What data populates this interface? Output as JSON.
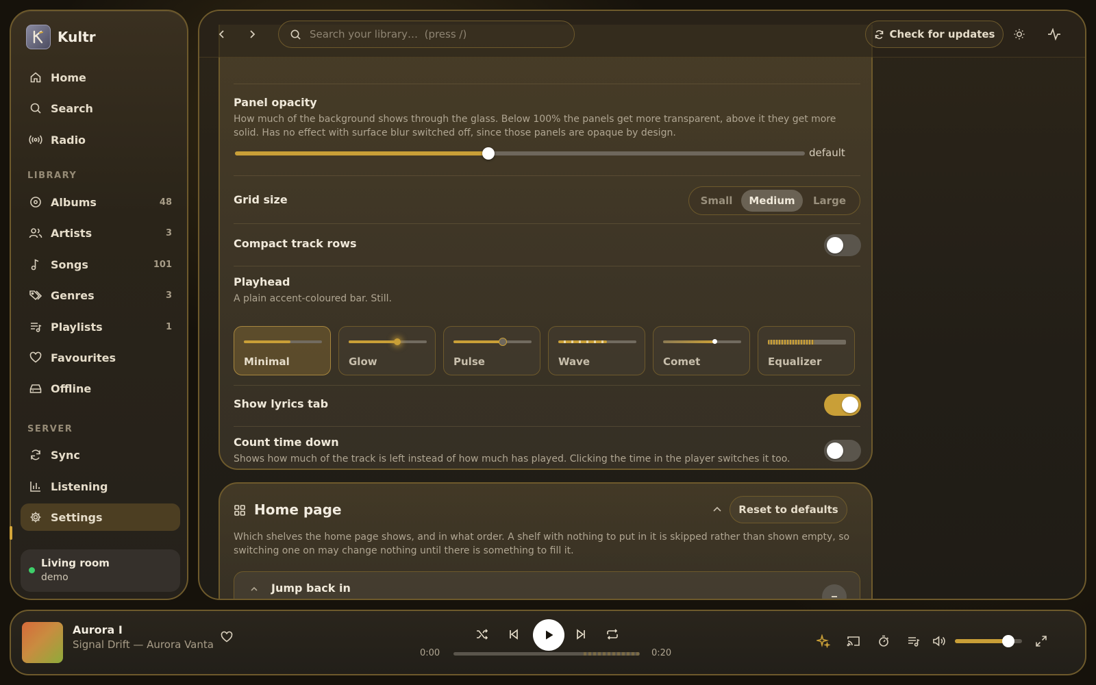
{
  "app": {
    "name": "Kultr"
  },
  "sidebar": {
    "nav": [
      {
        "label": "Home"
      },
      {
        "label": "Search"
      },
      {
        "label": "Radio"
      }
    ],
    "library_heading": "LIBRARY",
    "library": [
      {
        "label": "Albums",
        "count": "48"
      },
      {
        "label": "Artists",
        "count": "3"
      },
      {
        "label": "Songs",
        "count": "101"
      },
      {
        "label": "Genres",
        "count": "3"
      },
      {
        "label": "Playlists",
        "count": "1"
      },
      {
        "label": "Favourites",
        "count": ""
      },
      {
        "label": "Offline",
        "count": ""
      }
    ],
    "server_heading": "SERVER",
    "server_items": [
      {
        "label": "Sync"
      },
      {
        "label": "Listening"
      },
      {
        "label": "Settings",
        "active": true
      }
    ],
    "server": {
      "name": "Living room",
      "user": "demo",
      "status_color": "#3ecf6a"
    }
  },
  "topbar": {
    "search_placeholder": "Search your library…  (press /)",
    "update_label": "Check for updates"
  },
  "appearance": {
    "panel_opacity": {
      "title": "Panel opacity",
      "description": "How much of the background shows through the glass. Below 100% the panels get more transparent, above it they get more solid. Has no effect with surface blur switched off, since those panels are opaque by design.",
      "value_label": "default",
      "level": 0.445
    },
    "grid_size": {
      "title": "Grid size",
      "options": [
        "Small",
        "Medium",
        "Large"
      ],
      "selected": "Medium"
    },
    "compact_rows": {
      "title": "Compact track rows",
      "on": false
    },
    "playhead": {
      "title": "Playhead",
      "description": "A plain accent-coloured bar. Still.",
      "options": [
        "Minimal",
        "Glow",
        "Pulse",
        "Wave",
        "Comet",
        "Equalizer"
      ],
      "selected": "Minimal"
    },
    "lyrics_tab": {
      "title": "Show lyrics tab",
      "on": true
    },
    "count_down": {
      "title": "Count time down",
      "description": "Shows how much of the track is left instead of how much has played. Clicking the time in the player switches it too.",
      "on": false
    }
  },
  "home_page": {
    "title": "Home page",
    "reset_label": "Reset to defaults",
    "description": "Which shelves the home page shows, and in what order. A shelf with nothing to put in it is skipped rather than shown empty, so switching one on may change nothing until there is something to fill it.",
    "shelves": [
      {
        "title": "Jump back in"
      }
    ]
  },
  "player": {
    "title": "Aurora I",
    "subtitle": "Signal Drift — Aurora Vanta",
    "elapsed": "0:00",
    "total": "0:20",
    "progress": 0.0,
    "volume": 0.8
  },
  "colors": {
    "accent": "#c99f37",
    "border": "#6e5a2c"
  }
}
